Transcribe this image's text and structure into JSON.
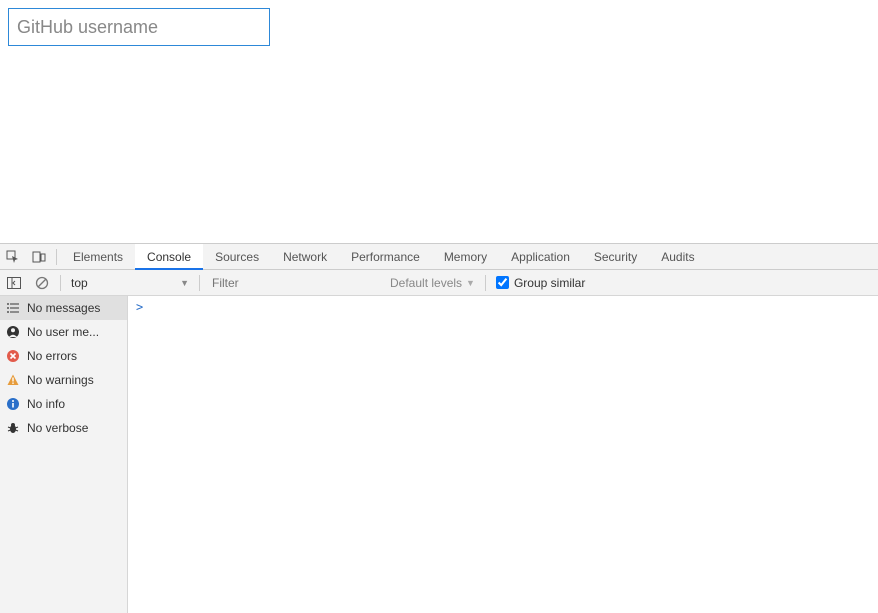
{
  "page": {
    "input_placeholder": "GitHub username",
    "input_value": ""
  },
  "devtools": {
    "tabs": {
      "elements": "Elements",
      "console": "Console",
      "sources": "Sources",
      "network": "Network",
      "performance": "Performance",
      "memory": "Memory",
      "application": "Application",
      "security": "Security",
      "audits": "Audits"
    },
    "active_tab": "console",
    "toolbar": {
      "context": "top",
      "filter_placeholder": "Filter",
      "levels": "Default levels",
      "group_label": "Group similar",
      "group_checked": true
    },
    "sidebar": {
      "no_messages": "No messages",
      "no_user_messages": "No user me...",
      "no_errors": "No errors",
      "no_warnings": "No warnings",
      "no_info": "No info",
      "no_verbose": "No verbose"
    },
    "prompt": ">"
  }
}
